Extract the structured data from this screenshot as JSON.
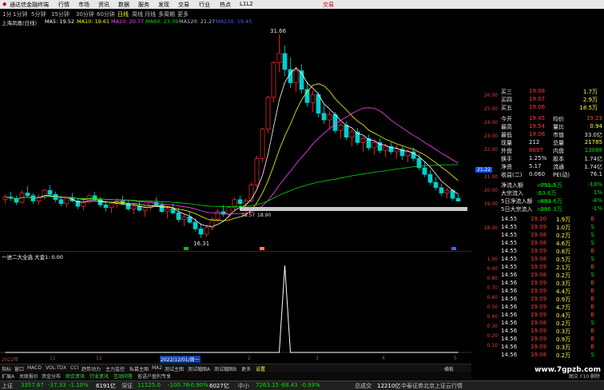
{
  "menubar": {
    "app_title": "通达信金融终端",
    "items": [
      "行情",
      "市场",
      "资讯",
      "数据",
      "服务",
      "发现",
      "交易",
      "行业",
      "热点",
      "L1L2"
    ],
    "right_label": "交易",
    "window_controls": [
      "minimize-icon",
      "maximize-icon",
      "close-icon"
    ]
  },
  "periodbar": {
    "items": [
      "1分",
      "1分钟",
      "5分钟",
      "15分钟",
      "30分钟",
      "60分钟",
      "日线",
      "周线",
      "月线",
      "多周期",
      "更多"
    ],
    "selected": "日线"
  },
  "ma_legend": {
    "stock": "上海凤凰(日线)",
    "items": [
      {
        "text": "MA5: 19.52",
        "color": "#ffffff"
      },
      {
        "text": "MA10: 19.61",
        "color": "#ffff00"
      },
      {
        "text": "MA20: 20.77",
        "color": "#ff40ff"
      },
      {
        "text": "MA60: 23.39",
        "color": "#00e000"
      },
      {
        "text": "MA120: 21.27",
        "color": "#c0c0c0"
      },
      {
        "text": "MA250: 19.45",
        "color": "#4040ff"
      }
    ]
  },
  "price_annotations": {
    "high": "31.66",
    "low1": "16.31",
    "low2": "18.57",
    "low3": "18.90"
  },
  "right_axis_labels": [
    "26.00",
    "25.00",
    "24.00",
    "23.00",
    "22.00",
    "21.00",
    "20.00",
    "19.00",
    "18.00",
    "1.00",
    "0.90",
    "0.80",
    "0.70",
    "0.60",
    "0.50",
    "0.40",
    "0.30",
    "0.20",
    "0.10"
  ],
  "current_price_tag": "21.22",
  "indicator_label": "一进二大全选  大金1: 0.00",
  "x_axis": [
    "2022年",
    "11",
    "12",
    "2022/12/01/周一",
    "2",
    "3",
    "4",
    "5"
  ],
  "indicator_tabs": [
    "指标",
    "窗口",
    "MACD",
    "VOL-TDX",
    "CCI",
    "趋势动力",
    "主力监控",
    "私募主图",
    "MA2",
    "测试主图",
    "测试幅图A",
    "测试幅图B",
    "更多",
    "设置"
  ],
  "bottom_tabs": [
    "扩展A",
    "关联报价",
    "资金分布",
    "综合资讯",
    "行业资讯",
    "互动问答",
    "俗语户盈利专享"
  ],
  "status_bar": [
    {
      "text": "上证",
      "color": "#c0c0c0"
    },
    {
      "text": "3357.67",
      "color": "#00e000"
    },
    {
      "text": "-37.33",
      "color": "#00e000"
    },
    {
      "text": "-1.10%",
      "color": "#00e000"
    },
    {
      "text": "6191亿",
      "color": "#ffffff"
    },
    {
      "text": "深证",
      "color": "#c0c0c0"
    },
    {
      "text": "11125.0",
      "color": "#00e000"
    },
    {
      "text": "-100.76",
      "color": "#00e000"
    },
    {
      "text": "-0.90%",
      "color": "#00e000"
    },
    {
      "text": "6027亿",
      "color": "#ffffff"
    },
    {
      "text": "中小",
      "color": "#c0c0c0"
    },
    {
      "text": "7263.15",
      "color": "#00e000"
    },
    {
      "text": "-68.43",
      "color": "#00e000"
    },
    {
      "text": "-0.93%",
      "color": "#00e000"
    },
    {
      "text": "总成交",
      "color": "#c0c0c0"
    },
    {
      "text": "12210亿",
      "color": "#ffffff"
    },
    {
      "text": "中泰证券北京上证云行情",
      "color": "#c0c0c0"
    }
  ],
  "quote": {
    "order_rows": [
      {
        "label": "买三",
        "price": "19.08",
        "vol": "1.7万"
      },
      {
        "label": "买四",
        "price": "19.07",
        "vol": "2.9万"
      },
      {
        "label": "买五",
        "price": "19.06",
        "vol": "18.5万"
      }
    ],
    "stats": [
      {
        "l1": "今开",
        "v1": "19.45",
        "c1": "#ff3b3b",
        "l2": "均价",
        "v2": "19.23",
        "c2": "#ff3b3b"
      },
      {
        "l1": "最高",
        "v1": "19.54",
        "c1": "#ff3b3b",
        "l2": "量比",
        "v2": "0.94",
        "c2": "#ffff40"
      },
      {
        "l1": "最低",
        "v1": "19.06",
        "c1": "#ff3b3b",
        "l2": "市值",
        "v2": "33.0亿",
        "c2": "#e8e8e8"
      },
      {
        "l1": "现量",
        "v1": "212",
        "c1": "#e8e8e8",
        "l2": "总量",
        "v2": "21785",
        "c2": "#ffff40"
      },
      {
        "l1": "外盘",
        "v1": "8697",
        "c1": "#ff3b3b",
        "l2": "内盘",
        "v2": "13088",
        "c2": "#00e000"
      },
      {
        "l1": "换手",
        "v1": "1.25%",
        "c1": "#e8e8e8",
        "l2": "股本",
        "v2": "1.74亿",
        "c2": "#e8e8e8"
      },
      {
        "l1": "净资",
        "v1": "5.17",
        "c1": "#e8e8e8",
        "l2": "流通",
        "v2": "1.74亿",
        "c2": "#e8e8e8"
      },
      {
        "l1": "收益(二)",
        "v1": "0.060",
        "c1": "#e8e8e8",
        "l2": "PE(动)",
        "v2": "76.1",
        "c2": "#e8e8e8"
      }
    ],
    "flows": [
      {
        "label": "净流入额",
        "value": "-751.5万",
        "pct": "-18%",
        "bar": 0.6
      },
      {
        "label": "大宗流入",
        "value": "53.6万",
        "pct": "1%",
        "bar": 0.1
      },
      {
        "label": "5日净流入额",
        "value": "-893.6万",
        "pct": "-4%",
        "bar": 0.45
      },
      {
        "label": "5日大宗流入",
        "value": "-296.3万",
        "pct": "-1%",
        "bar": 0.3
      }
    ],
    "ticks": [
      {
        "time": "14:55",
        "price": "19.10",
        "vol": "1.9万",
        "bs": "B",
        "pc": "#ff3b3b",
        "bc": "#ff3b3b"
      },
      {
        "time": "14:55",
        "price": "19.09",
        "vol": "1.0万",
        "bs": "S",
        "pc": "#ff3b3b",
        "bc": "#00e000"
      },
      {
        "time": "14:55",
        "price": "19.08",
        "vol": "0.2万",
        "bs": "S",
        "pc": "#ff3b3b",
        "bc": "#00e000"
      },
      {
        "time": "14:55",
        "price": "19.08",
        "vol": "4.6万",
        "bs": "S",
        "pc": "#ff3b3b",
        "bc": "#00e000"
      },
      {
        "time": "14:55",
        "price": "19.09",
        "vol": "0.8万",
        "bs": "B",
        "pc": "#ff3b3b",
        "bc": "#ff3b3b"
      },
      {
        "time": "14:55",
        "price": "19.08",
        "vol": "0.5万",
        "bs": "S",
        "pc": "#ff3b3b",
        "bc": "#00e000"
      },
      {
        "time": "14:55",
        "price": "19.09",
        "vol": "2.1万",
        "bs": "B",
        "pc": "#ff3b3b",
        "bc": "#ff3b3b"
      },
      {
        "time": "14:56",
        "price": "19.08",
        "vol": "0.2万",
        "bs": "S",
        "pc": "#ff3b3b",
        "bc": "#00e000"
      },
      {
        "time": "14:56",
        "price": "19.09",
        "vol": "0.3万",
        "bs": "B",
        "pc": "#ff3b3b",
        "bc": "#ff3b3b"
      },
      {
        "time": "14:56",
        "price": "19.09",
        "vol": "4.4万",
        "bs": "B",
        "pc": "#ff3b3b",
        "bc": "#ff3b3b"
      },
      {
        "time": "14:56",
        "price": "19.09",
        "vol": "0.9万",
        "bs": "B",
        "pc": "#ff3b3b",
        "bc": "#ff3b3b"
      },
      {
        "time": "14:56",
        "price": "19.09",
        "vol": "4.7万",
        "bs": "B",
        "pc": "#ff3b3b",
        "bc": "#ff3b3b"
      },
      {
        "time": "14:56",
        "price": "19.09",
        "vol": "0.4万",
        "bs": "B",
        "pc": "#ff3b3b",
        "bc": "#ff3b3b"
      },
      {
        "time": "14:56",
        "price": "19.08",
        "vol": "0.2万",
        "bs": "S",
        "pc": "#ff3b3b",
        "bc": "#00e000"
      },
      {
        "time": "14:56",
        "price": "19.09",
        "vol": "0.3万",
        "bs": "B",
        "pc": "#ff3b3b",
        "bc": "#ff3b3b"
      },
      {
        "time": "14:56",
        "price": "19.09",
        "vol": "0.9万",
        "bs": "B",
        "pc": "#ff3b3b",
        "bc": "#ff3b3b"
      },
      {
        "time": "14:56",
        "price": "19.09",
        "vol": "0.3万",
        "bs": "B",
        "pc": "#ff3b3b",
        "bc": "#ff3b3b"
      },
      {
        "time": "14:56",
        "price": "19.08",
        "vol": "0.2万",
        "bs": "S",
        "pc": "#ff3b3b",
        "bc": "#00e000"
      }
    ]
  },
  "watermark": "www.7gpzb.com",
  "side_tabs": [
    "横板",
    "图文",
    "F10",
    "删除"
  ],
  "chart_data": {
    "type": "candlestick",
    "title": "上海凤凰(日线)",
    "price_range": [
      16,
      32
    ],
    "candles": [
      [
        19.2,
        19.6,
        18.9,
        19.4
      ],
      [
        19.4,
        19.8,
        19.1,
        19.3
      ],
      [
        19.3,
        19.5,
        18.8,
        19.0
      ],
      [
        19.0,
        19.9,
        18.9,
        19.7
      ],
      [
        19.7,
        20.2,
        19.4,
        19.5
      ],
      [
        19.5,
        19.7,
        18.9,
        19.1
      ],
      [
        19.1,
        19.6,
        18.8,
        19.4
      ],
      [
        19.4,
        20.0,
        19.2,
        19.9
      ],
      [
        19.9,
        20.3,
        19.5,
        19.6
      ],
      [
        19.6,
        19.8,
        19.0,
        19.2
      ],
      [
        19.2,
        19.5,
        18.7,
        18.9
      ],
      [
        18.9,
        19.4,
        18.6,
        19.3
      ],
      [
        19.3,
        19.7,
        19.0,
        19.1
      ],
      [
        19.1,
        19.3,
        18.5,
        18.7
      ],
      [
        18.7,
        19.2,
        18.4,
        19.0
      ],
      [
        19.0,
        19.6,
        18.9,
        19.5
      ],
      [
        19.5,
        19.8,
        19.1,
        19.2
      ],
      [
        19.2,
        19.4,
        18.6,
        18.8
      ],
      [
        18.8,
        19.1,
        18.3,
        18.6
      ],
      [
        18.6,
        19.0,
        18.2,
        18.9
      ],
      [
        18.9,
        19.3,
        18.6,
        19.1
      ],
      [
        19.1,
        19.5,
        18.8,
        18.9
      ],
      [
        18.9,
        19.2,
        18.4,
        18.5
      ],
      [
        18.5,
        18.9,
        18.1,
        18.7
      ],
      [
        18.7,
        19.0,
        18.3,
        18.4
      ],
      [
        18.4,
        18.8,
        17.9,
        18.6
      ],
      [
        18.6,
        19.1,
        18.4,
        19.0
      ],
      [
        19.0,
        19.4,
        18.7,
        18.8
      ],
      [
        18.8,
        19.0,
        18.2,
        18.3
      ],
      [
        18.3,
        18.7,
        17.8,
        18.5
      ],
      [
        18.5,
        18.9,
        18.1,
        18.2
      ],
      [
        18.2,
        18.6,
        17.5,
        17.7
      ],
      [
        17.7,
        18.1,
        17.2,
        17.9
      ],
      [
        17.9,
        18.3,
        17.4,
        17.5
      ],
      [
        17.5,
        17.8,
        16.8,
        17.0
      ],
      [
        17.0,
        17.4,
        16.31,
        16.6
      ],
      [
        16.6,
        17.3,
        16.4,
        17.1
      ],
      [
        17.1,
        17.9,
        16.9,
        17.7
      ],
      [
        17.7,
        18.5,
        17.5,
        18.3
      ],
      [
        18.3,
        18.8,
        17.9,
        18.1
      ],
      [
        18.1,
        18.7,
        17.8,
        18.6
      ],
      [
        18.6,
        19.4,
        18.4,
        19.2
      ],
      [
        19.2,
        19.5,
        18.6,
        18.9
      ],
      [
        18.9,
        19.3,
        18.57,
        19.1
      ],
      [
        19.1,
        20.5,
        19.0,
        20.3
      ],
      [
        20.3,
        22.5,
        20.1,
        22.3
      ],
      [
        22.3,
        24.6,
        22.0,
        24.5
      ],
      [
        24.5,
        27.0,
        24.2,
        26.9
      ],
      [
        26.9,
        29.6,
        26.5,
        29.5
      ],
      [
        29.5,
        31.66,
        28.8,
        30.2
      ],
      [
        30.2,
        30.8,
        28.5,
        29.0
      ],
      [
        29.0,
        29.9,
        27.6,
        28.0
      ],
      [
        28.0,
        29.2,
        27.3,
        28.9
      ],
      [
        28.9,
        29.4,
        27.2,
        27.5
      ],
      [
        27.5,
        28.1,
        26.2,
        26.5
      ],
      [
        26.5,
        27.4,
        25.8,
        27.1
      ],
      [
        27.1,
        27.3,
        25.4,
        25.7
      ],
      [
        25.7,
        26.3,
        24.9,
        25.2
      ],
      [
        25.2,
        25.9,
        24.5,
        25.6
      ],
      [
        25.6,
        25.8,
        24.2,
        24.4
      ],
      [
        24.4,
        25.0,
        23.8,
        24.8
      ],
      [
        24.8,
        25.1,
        23.7,
        23.9
      ],
      [
        23.9,
        24.5,
        23.2,
        24.3
      ],
      [
        24.3,
        24.6,
        23.3,
        23.5
      ],
      [
        23.5,
        24.0,
        22.8,
        23.8
      ],
      [
        23.8,
        24.1,
        22.9,
        23.1
      ],
      [
        23.1,
        23.7,
        22.6,
        23.5
      ],
      [
        23.5,
        23.8,
        22.7,
        22.9
      ],
      [
        22.9,
        23.4,
        22.4,
        23.2
      ],
      [
        23.2,
        23.5,
        22.6,
        22.8
      ],
      [
        22.8,
        23.3,
        22.3,
        23.0
      ],
      [
        23.0,
        23.2,
        22.2,
        22.5
      ],
      [
        22.5,
        23.0,
        22.0,
        22.8
      ],
      [
        22.8,
        23.1,
        22.1,
        22.3
      ],
      [
        22.3,
        22.6,
        21.4,
        21.6
      ],
      [
        21.6,
        22.0,
        20.9,
        21.1
      ],
      [
        21.1,
        21.4,
        20.3,
        20.5
      ],
      [
        20.5,
        20.9,
        19.9,
        20.1
      ],
      [
        20.1,
        20.4,
        19.5,
        19.7
      ],
      [
        19.7,
        20.1,
        19.3,
        19.9
      ],
      [
        19.9,
        20.0,
        19.1,
        19.3
      ],
      [
        19.3,
        19.6,
        19.06,
        19.09
      ]
    ],
    "indicator": {
      "name": "一进二大全选",
      "series": "大金1",
      "value": 0.0,
      "spike_index": 50,
      "spike_value": 1.0,
      "range": [
        0,
        1.05
      ]
    }
  }
}
